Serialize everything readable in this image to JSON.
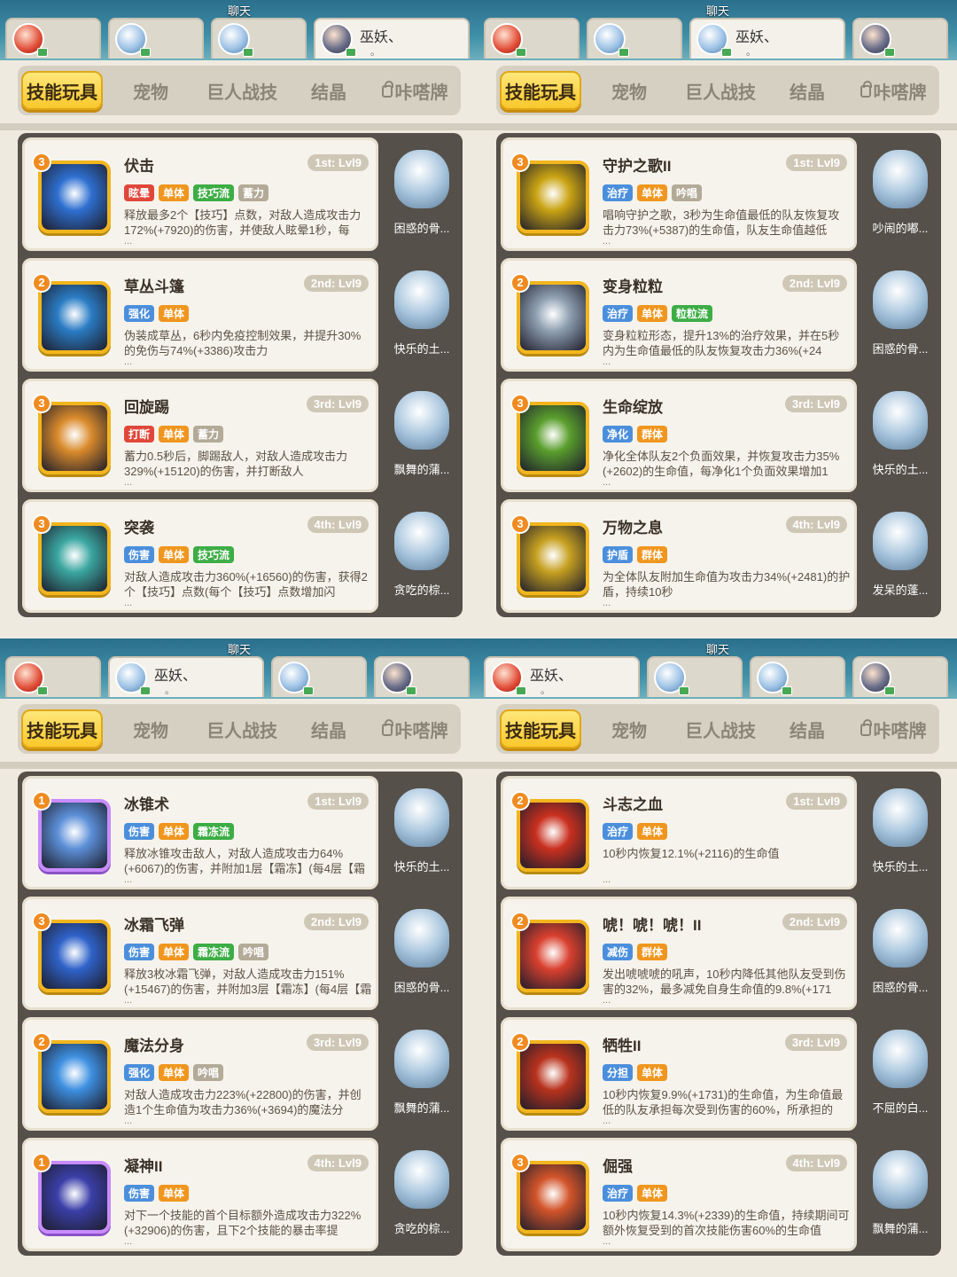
{
  "colors": {
    "orange": "#f0961e",
    "green": "#3dad45",
    "blue": "#4b8fdc",
    "red": "#e0473a",
    "gray": "#b3aa98",
    "yellow": "#f9c82c"
  },
  "panels": [
    {
      "chat": "聊天",
      "tabs": [
        {
          "label": "技能玩具",
          "locked": false,
          "active": true
        },
        {
          "label": "宠物",
          "locked": false,
          "active": false
        },
        {
          "label": "巨人战技",
          "locked": false,
          "active": false
        },
        {
          "label": "结晶",
          "locked": false,
          "active": false
        },
        {
          "label": "咔嗒牌",
          "locked": true,
          "active": false
        }
      ],
      "avatars": [
        {
          "style": "red",
          "name": "",
          "sub": "",
          "active": false
        },
        {
          "style": "blue",
          "name": "",
          "sub": "",
          "active": false
        },
        {
          "style": "blue",
          "name": "",
          "sub": "",
          "active": false
        },
        {
          "style": "dark",
          "name": "巫妖、",
          "sub": "。",
          "active": true
        }
      ],
      "cards": [
        {
          "title": "伏击",
          "rank": "1st: Lvl9",
          "badge": "3",
          "up": false,
          "icon_color": "#2e6fd0",
          "purple": false,
          "tags": [
            {
              "t": "眩晕",
              "c": "red"
            },
            {
              "t": "单体",
              "c": "orange"
            },
            {
              "t": "技巧流",
              "c": "green"
            },
            {
              "t": "蓄力",
              "c": "gray"
            }
          ],
          "desc": "释放最多2个【技巧】点数，对敌人造成攻击力172%(+7920)的伤害，并使敌人眩晕1秒，每",
          "pet": "困惑的骨..."
        },
        {
          "title": "草丛斗篷",
          "rank": "2nd: Lvl9",
          "badge": "2",
          "up": false,
          "icon_color": "#2a7cc4",
          "purple": false,
          "tags": [
            {
              "t": "强化",
              "c": "blue"
            },
            {
              "t": "单体",
              "c": "orange"
            }
          ],
          "desc": "伪装成草丛，6秒内免疫控制效果，并提升30%的免伤与74%(+3386)攻击力",
          "pet": "快乐的土..."
        },
        {
          "title": "回旋踢",
          "rank": "3rd: Lvl9",
          "badge": "3",
          "up": false,
          "icon_color": "#d98a2b",
          "purple": false,
          "tags": [
            {
              "t": "打断",
              "c": "red"
            },
            {
              "t": "单体",
              "c": "orange"
            },
            {
              "t": "蓄力",
              "c": "gray"
            }
          ],
          "desc": "蓄力0.5秒后，脚踢敌人，对敌人造成攻击力329%(+15120)的伤害，并打断敌人",
          "pet": "飘舞的蒲..."
        },
        {
          "title": "突袭",
          "rank": "4th: Lvl9",
          "badge": "3",
          "up": false,
          "icon_color": "#3aa6a0",
          "purple": false,
          "tags": [
            {
              "t": "伤害",
              "c": "blue"
            },
            {
              "t": "单体",
              "c": "orange"
            },
            {
              "t": "技巧流",
              "c": "green"
            }
          ],
          "desc": "对敌人造成攻击力360%(+16560)的伤害，获得2个【技巧】点数(每个【技巧】点数增加闪",
          "pet": "贪吃的棕..."
        }
      ]
    },
    {
      "chat": "聊天",
      "tabs": [
        {
          "label": "技能玩具",
          "locked": false,
          "active": true
        },
        {
          "label": "宠物",
          "locked": false,
          "active": false
        },
        {
          "label": "巨人战技",
          "locked": false,
          "active": false
        },
        {
          "label": "结晶",
          "locked": false,
          "active": false
        },
        {
          "label": "咔嗒牌",
          "locked": true,
          "active": false
        }
      ],
      "avatars": [
        {
          "style": "red",
          "name": "",
          "sub": "",
          "active": false
        },
        {
          "style": "blue",
          "name": "",
          "sub": "",
          "active": false
        },
        {
          "style": "blue",
          "name": "巫妖、",
          "sub": "。",
          "active": true
        },
        {
          "style": "dark",
          "name": "",
          "sub": "",
          "active": false
        }
      ],
      "cards": [
        {
          "title": "守护之歌II",
          "rank": "1st: Lvl9",
          "badge": "3",
          "up": true,
          "icon_color": "#c9a313",
          "purple": false,
          "tags": [
            {
              "t": "治疗",
              "c": "blue"
            },
            {
              "t": "单体",
              "c": "orange"
            },
            {
              "t": "吟唱",
              "c": "gray"
            }
          ],
          "desc": "唱响守护之歌，3秒为生命值最低的队友恢复攻击力73%(+5387)的生命值，队友生命值越低",
          "pet": "吵闹的嘟..."
        },
        {
          "title": "变身粒粒",
          "rank": "2nd: Lvl9",
          "badge": "2",
          "up": false,
          "icon_color": "#8fa0b2",
          "purple": false,
          "tags": [
            {
              "t": "治疗",
              "c": "blue"
            },
            {
              "t": "单体",
              "c": "orange"
            },
            {
              "t": "粒粒流",
              "c": "green"
            }
          ],
          "desc": "变身粒粒形态，提升13%的治疗效果，并在5秒内为生命值最低的队友恢复攻击力36%(+24",
          "pet": "困惑的骨..."
        },
        {
          "title": "生命绽放",
          "rank": "3rd: Lvl9",
          "badge": "3",
          "up": false,
          "icon_color": "#5a9e2d",
          "purple": false,
          "tags": [
            {
              "t": "净化",
              "c": "blue"
            },
            {
              "t": "群体",
              "c": "orange"
            }
          ],
          "desc": "净化全体队友2个负面效果，并恢复攻击力35%(+2602)的生命值，每净化1个负面效果增加1",
          "pet": "快乐的土..."
        },
        {
          "title": "万物之息",
          "rank": "4th: Lvl9",
          "badge": "3",
          "up": false,
          "icon_color": "#c6a020",
          "purple": false,
          "tags": [
            {
              "t": "护盾",
              "c": "blue"
            },
            {
              "t": "群体",
              "c": "orange"
            }
          ],
          "desc": "为全体队友附加生命值为攻击力34%(+2481)的护盾，持续10秒",
          "pet": "发呆的蓬..."
        }
      ]
    },
    {
      "chat": "聊天",
      "tabs": [
        {
          "label": "技能玩具",
          "locked": false,
          "active": true
        },
        {
          "label": "宠物",
          "locked": false,
          "active": false
        },
        {
          "label": "巨人战技",
          "locked": false,
          "active": false
        },
        {
          "label": "结晶",
          "locked": false,
          "active": false
        },
        {
          "label": "咔嗒牌",
          "locked": true,
          "active": false
        }
      ],
      "avatars": [
        {
          "style": "red",
          "name": "",
          "sub": "",
          "active": false
        },
        {
          "style": "blue",
          "name": "巫妖、",
          "sub": "。",
          "active": true
        },
        {
          "style": "blue",
          "name": "",
          "sub": "",
          "active": false
        },
        {
          "style": "dark",
          "name": "",
          "sub": "",
          "active": false
        }
      ],
      "cards": [
        {
          "title": "冰锥术",
          "rank": "1st: Lvl9",
          "badge": "1",
          "up": false,
          "icon_color": "#5c8fd8",
          "purple": true,
          "tags": [
            {
              "t": "伤害",
              "c": "blue"
            },
            {
              "t": "单体",
              "c": "orange"
            },
            {
              "t": "霜冻流",
              "c": "green"
            }
          ],
          "desc": "释放冰锥攻击敌人，对敌人造成攻击力64%(+6067)的伤害，并附加1层【霜冻】(每4层【霜",
          "pet": "快乐的土..."
        },
        {
          "title": "冰霜飞弹",
          "rank": "2nd: Lvl9",
          "badge": "3",
          "up": false,
          "icon_color": "#2f62c9",
          "purple": false,
          "tags": [
            {
              "t": "伤害",
              "c": "blue"
            },
            {
              "t": "单体",
              "c": "orange"
            },
            {
              "t": "霜冻流",
              "c": "green"
            },
            {
              "t": "吟唱",
              "c": "gray"
            }
          ],
          "desc": "释放3枚冰霜飞弹，对敌人造成攻击力151%(+15467)的伤害，并附加3层【霜冻】(每4层【霜",
          "pet": "困惑的骨..."
        },
        {
          "title": "魔法分身",
          "rank": "3rd: Lvl9",
          "badge": "2",
          "up": false,
          "icon_color": "#3d8fe0",
          "purple": false,
          "tags": [
            {
              "t": "强化",
              "c": "blue"
            },
            {
              "t": "单体",
              "c": "orange"
            },
            {
              "t": "吟唱",
              "c": "gray"
            }
          ],
          "desc": "对敌人造成攻击力223%(+22800)的伤害，并创造1个生命值为攻击力36%(+3694)的魔法分",
          "pet": "飘舞的蒲..."
        },
        {
          "title": "凝神II",
          "rank": "4th: Lvl9",
          "badge": "1",
          "up": true,
          "icon_color": "#3b3fa8",
          "purple": true,
          "tags": [
            {
              "t": "伤害",
              "c": "blue"
            },
            {
              "t": "单体",
              "c": "orange"
            }
          ],
          "desc": "对下一个技能的首个目标额外造成攻击力322%(+32906)的伤害，且下2个技能的暴击率提",
          "pet": "贪吃的棕..."
        }
      ]
    },
    {
      "chat": "聊天",
      "tabs": [
        {
          "label": "技能玩具",
          "locked": false,
          "active": true
        },
        {
          "label": "宠物",
          "locked": false,
          "active": false
        },
        {
          "label": "巨人战技",
          "locked": false,
          "active": false
        },
        {
          "label": "结晶",
          "locked": false,
          "active": false
        },
        {
          "label": "咔嗒牌",
          "locked": true,
          "active": false
        }
      ],
      "avatars": [
        {
          "style": "red",
          "name": "巫妖、",
          "sub": "。",
          "active": true
        },
        {
          "style": "blue",
          "name": "",
          "sub": "",
          "active": false
        },
        {
          "style": "blue",
          "name": "",
          "sub": "",
          "active": false
        },
        {
          "style": "dark",
          "name": "",
          "sub": "",
          "active": false
        }
      ],
      "cards": [
        {
          "title": "斗志之血",
          "rank": "1st: Lvl9",
          "badge": "2",
          "up": false,
          "icon_color": "#c9301f",
          "purple": false,
          "tags": [
            {
              "t": "治疗",
              "c": "blue"
            },
            {
              "t": "单体",
              "c": "orange"
            }
          ],
          "desc": "10秒内恢复12.1%(+2116)的生命值",
          "pet": "快乐的土..."
        },
        {
          "title": "唬！唬！唬！II",
          "rank": "2nd: Lvl9",
          "badge": "2",
          "up": true,
          "icon_color": "#d9402e",
          "purple": false,
          "tags": [
            {
              "t": "减伤",
              "c": "blue"
            },
            {
              "t": "群体",
              "c": "orange"
            }
          ],
          "desc": "发出唬唬唬的吼声，10秒内降低其他队友受到伤害的32%，最多减免自身生命值的9.8%(+171",
          "pet": "困惑的骨..."
        },
        {
          "title": "牺牲II",
          "rank": "3rd: Lvl9",
          "badge": "2",
          "up": true,
          "icon_color": "#b8321d",
          "purple": false,
          "tags": [
            {
              "t": "分担",
              "c": "blue"
            },
            {
              "t": "单体",
              "c": "orange"
            }
          ],
          "desc": "10秒内恢复9.9%(+1731)的生命值，为生命值最低的队友承担每次受到伤害的60%，所承担的",
          "pet": "不屈的白..."
        },
        {
          "title": "倔强",
          "rank": "4th: Lvl9",
          "badge": "3",
          "up": false,
          "icon_color": "#d2542a",
          "purple": false,
          "tags": [
            {
              "t": "治疗",
              "c": "blue"
            },
            {
              "t": "单体",
              "c": "orange"
            }
          ],
          "desc": "10秒内恢复14.3%(+2339)的生命值，持续期间可额外恢复受到的首次技能伤害60%的生命值",
          "pet": "飘舞的蒲..."
        }
      ]
    }
  ]
}
